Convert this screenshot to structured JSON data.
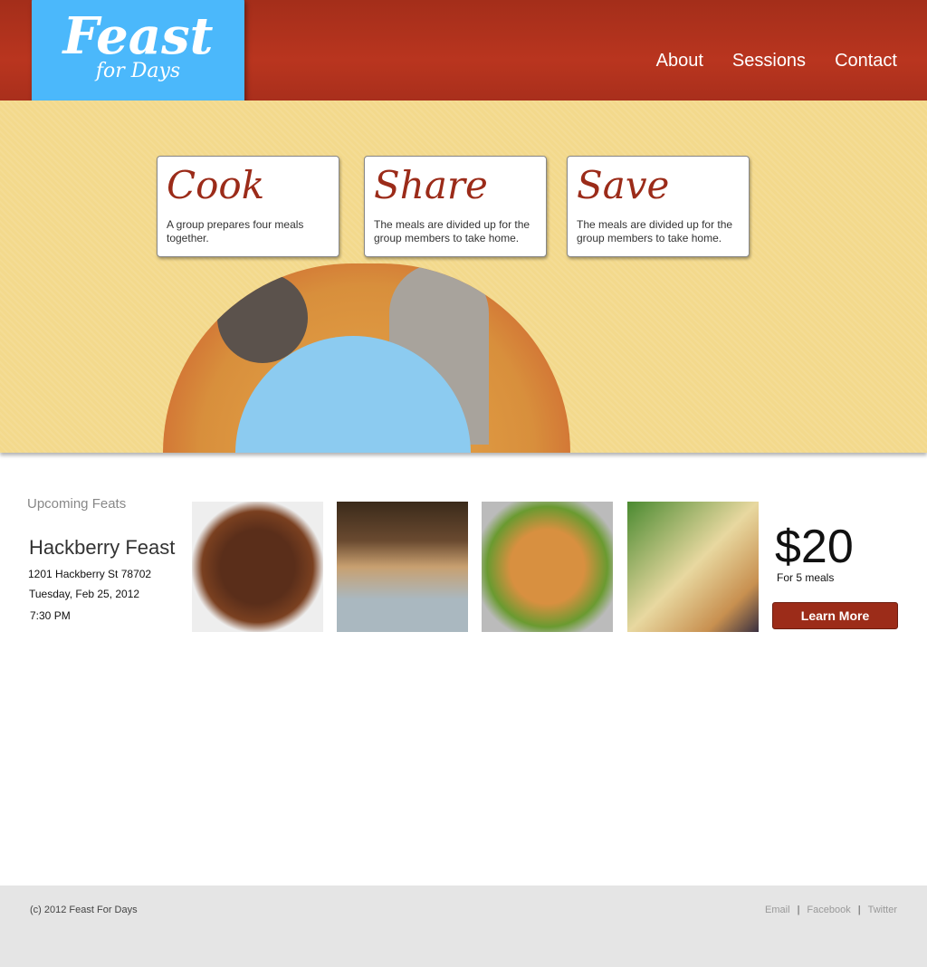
{
  "logo": {
    "title": "Feast",
    "subtitle": "for Days"
  },
  "nav": [
    "About",
    "Sessions",
    "Contact"
  ],
  "cards": [
    {
      "title": "Cook",
      "text": "A group prepares four meals together."
    },
    {
      "title": "Share",
      "text": "The meals are divided up for the group members to take home."
    },
    {
      "title": "Save",
      "text": "The meals are divided up for the group members to take home."
    }
  ],
  "upcoming": {
    "label": "Upcoming Feats",
    "title": "Hackberry Feast",
    "address": "1201 Hackberry St 78702",
    "date": "Tuesday, Feb 25, 2012",
    "time": "7:30 PM"
  },
  "price": {
    "amount": "$20",
    "note": "For 5 meals",
    "button": "Learn More"
  },
  "footer": {
    "copyright": "(c) 2012 Feast For Days",
    "links": [
      "Email",
      "Facebook",
      "Twitter"
    ]
  }
}
